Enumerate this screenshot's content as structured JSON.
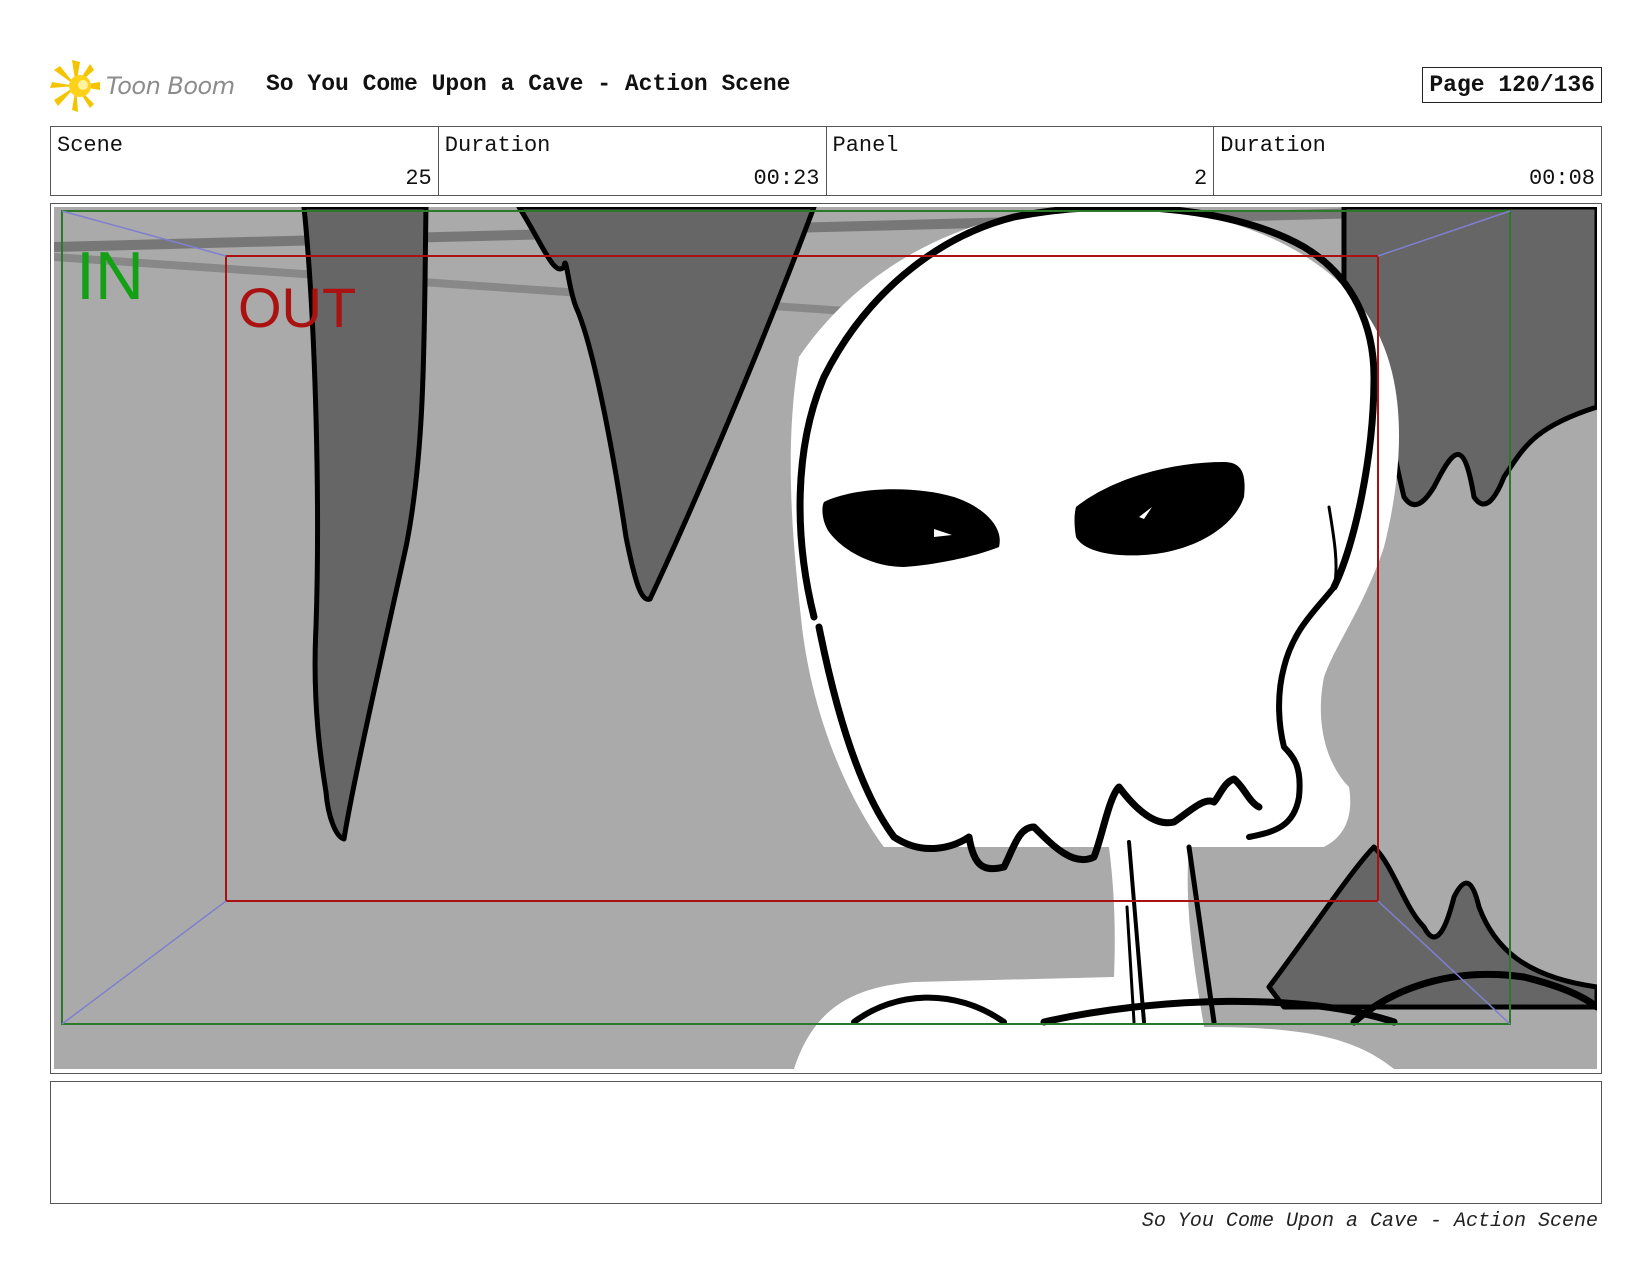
{
  "header": {
    "logo_text": "Toon Boom",
    "title": "So You Come Upon a Cave - Action Scene",
    "page": "Page 120/136"
  },
  "info": {
    "scene_label": "Scene",
    "scene_value": "25",
    "scene_duration_label": "Duration",
    "scene_duration_value": "00:23",
    "panel_label": "Panel",
    "panel_value": "2",
    "panel_duration_label": "Duration",
    "panel_duration_value": "00:08"
  },
  "panel": {
    "in_label": "IN",
    "out_label": "OUT",
    "in_color": "#14a014",
    "out_color": "#aa1111"
  },
  "footer": {
    "text": "So You Come Upon a Cave - Action Scene"
  }
}
